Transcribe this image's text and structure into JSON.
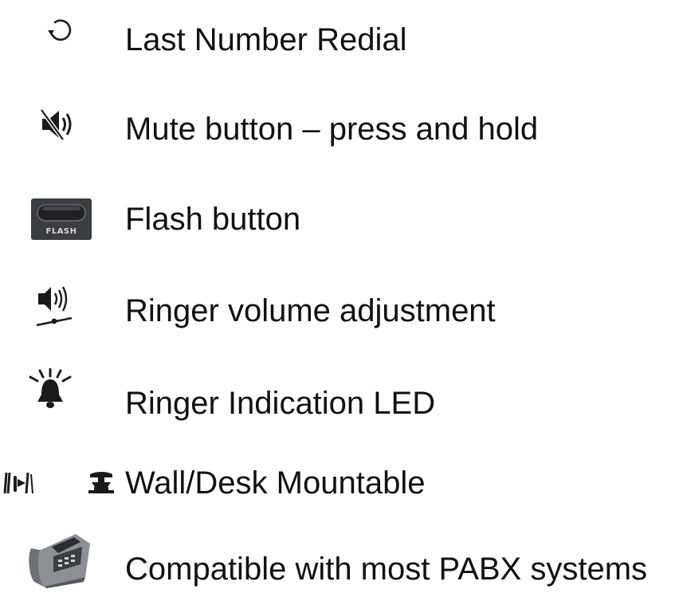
{
  "features": [
    {
      "icon": "redial-icon",
      "label": "Last Number Redial"
    },
    {
      "icon": "mute-icon",
      "label": "Mute button – press and hold"
    },
    {
      "icon": "flash-button-icon",
      "icon_text": "FLASH",
      "label": "Flash button"
    },
    {
      "icon": "ringer-volume-icon",
      "label": "Ringer volume adjustment"
    },
    {
      "icon": "ringer-led-bell-icon",
      "label": "Ringer Indication LED"
    },
    {
      "icon": "wall-desk-mount-icons",
      "label": "Wall/Desk Mountable"
    },
    {
      "icon": "desk-phone-icon",
      "label": "Compatible with most PABX systems"
    }
  ],
  "colors": {
    "text": "#111111",
    "icon_dark": "#1a1a1a",
    "flash_face": "#3a3d42"
  }
}
